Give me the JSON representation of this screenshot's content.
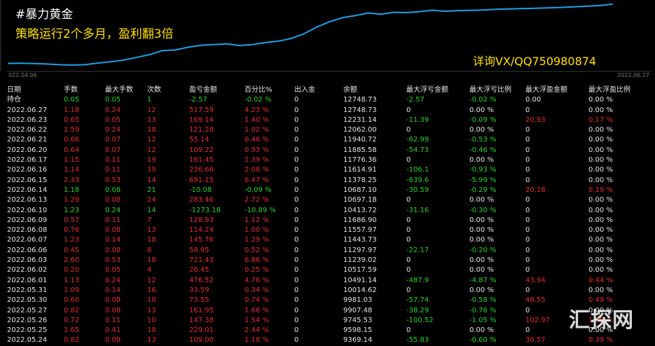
{
  "titles": {
    "strategy_name": "#暴力黄金",
    "subtitle": "策略运行2个多月，盈利翻3倍",
    "contact": "详询VX/QQ750980874"
  },
  "chart_data": {
    "type": "line",
    "x_start_label": "022.04.06",
    "x_end_label": "2022.06.27",
    "color": "#1ea0e6",
    "values": [
      12,
      12.3,
      11.8,
      11,
      10,
      9.5,
      10.2,
      12.5,
      14.5,
      17,
      21,
      25,
      31,
      32,
      36,
      39,
      40,
      41,
      38.5,
      40,
      43,
      45,
      49,
      56,
      66,
      74,
      80,
      83,
      87,
      85,
      88,
      87.5,
      89,
      91,
      89.5,
      90.5,
      90.8,
      91.5,
      92.5,
      93,
      93.5,
      94,
      94.5,
      95.2,
      96,
      97,
      98,
      100
    ],
    "ylim": [
      0,
      100
    ]
  },
  "table": {
    "columns": [
      "日期",
      "手数",
      "最大手数",
      "次数",
      "盈亏金额",
      "百分比%",
      "出入金",
      "余额",
      "最大浮亏金额",
      "最大浮亏比例",
      "最大浮盈金额",
      "最大浮盈比例"
    ],
    "rows": [
      [
        "持仓",
        "0.05",
        "0.05",
        "1",
        "-2.57",
        "-0.02 %",
        "0",
        "12748.73",
        "-2.57",
        "-0.02 %",
        "0.00",
        "0.00 %"
      ],
      [
        "2022.06.27",
        "1.18",
        "0.24",
        "12",
        "517.59",
        "4.23 %",
        "0",
        "12748.73",
        "0",
        "0.00 %",
        "0",
        "0.00 %"
      ],
      [
        "2022.06.23",
        "0.65",
        "0.05",
        "13",
        "169.14",
        "1.40 %",
        "0",
        "12231.14",
        "-11.39",
        "-0.09 %",
        "20.93",
        "0.17 %"
      ],
      [
        "2022.06.22",
        "1.59",
        "0.24",
        "18",
        "121.28",
        "1.02 %",
        "0",
        "12062.00",
        "0",
        "0.00 %",
        "0",
        "0.00 %"
      ],
      [
        "2022.06.21",
        "0.66",
        "0.07",
        "12",
        "55.14",
        "0.46 %",
        "0",
        "11940.72",
        "-62.99",
        "-0.53 %",
        "0",
        "0.00 %"
      ],
      [
        "2022.06.20",
        "0.64",
        "0.07",
        "12",
        "109.22",
        "0.93 %",
        "0",
        "11885.58",
        "-54.73",
        "-0.46 %",
        "0",
        "0.00 %"
      ],
      [
        "2022.06.17",
        "1.15",
        "0.11",
        "19",
        "161.45",
        "1.39 %",
        "0",
        "11776.36",
        "0",
        "0.00 %",
        "0",
        "0.00 %"
      ],
      [
        "2022.06.16",
        "1.14",
        "0.11",
        "19",
        "236.66",
        "2.08 %",
        "0",
        "11614.91",
        "-106.1",
        "-0.93 %",
        "0",
        "0.00 %"
      ],
      [
        "2022.06.15",
        "2.33",
        "0.53",
        "14",
        "691.15",
        "6.47 %",
        "0",
        "11378.25",
        "-639.6",
        "-5.99 %",
        "0",
        "0.00 %"
      ],
      [
        "2022.06.14",
        "1.18",
        "0.08",
        "21",
        "-10.08",
        "-0.09 %",
        "0",
        "10687.10",
        "-30.59",
        "-0.29 %",
        "20.18",
        "0.19 %"
      ],
      [
        "2022.06.13",
        "1.29",
        "0.08",
        "24",
        "283.46",
        "2.72 %",
        "0",
        "10697.18",
        "0",
        "0.00 %",
        "0",
        "0.00 %"
      ],
      [
        "2022.06.10",
        "1.23",
        "0.24",
        "14",
        "-1273.18",
        "-10.89 %",
        "0",
        "10413.72",
        "-31.16",
        "-0.30 %",
        "0",
        "0.00 %"
      ],
      [
        "2022.06.09",
        "0.57",
        "0.11",
        "7",
        "128.93",
        "1.12 %",
        "0",
        "11686.90",
        "0",
        "0.00 %",
        "0",
        "0.00 %"
      ],
      [
        "2022.06.08",
        "0.76",
        "0.08",
        "13",
        "114.24",
        "1.00 %",
        "0",
        "11557.97",
        "0",
        "0.00 %",
        "0",
        "0.00 %"
      ],
      [
        "2022.06.07",
        "1.23",
        "0.14",
        "18",
        "145.76",
        "1.29 %",
        "0",
        "11443.73",
        "0",
        "0.00 %",
        "0",
        "0.00 %"
      ],
      [
        "2022.06.06",
        "0.45",
        "0.08",
        "8",
        "58.95",
        "0.52 %",
        "0",
        "11297.97",
        "-22.17",
        "-0.20 %",
        "0",
        "0.00 %"
      ],
      [
        "2022.06.03",
        "2.60",
        "0.53",
        "18",
        "721.43",
        "6.86 %",
        "0",
        "11239.02",
        "0",
        "0.00 %",
        "0",
        "0.00 %"
      ],
      [
        "2022.06.02",
        "0.20",
        "0.05",
        "4",
        "26.45",
        "0.25 %",
        "0",
        "10517.59",
        "0",
        "0.00 %",
        "0",
        "0.00 %"
      ],
      [
        "2022.06.01",
        "1.13",
        "0.24",
        "12",
        "476.52",
        "4.76 %",
        "0",
        "10491.14",
        "-487.9",
        "-4.87 %",
        "43.94",
        "0.44 %"
      ],
      [
        "2022.05.31",
        "1.09",
        "0.14",
        "16",
        "33.59",
        "0.34 %",
        "0",
        "10014.62",
        "0",
        "0.00 %",
        "0",
        "0.00 %"
      ],
      [
        "2022.05.30",
        "0.60",
        "0.08",
        "10",
        "73.55",
        "0.74 %",
        "0",
        "9981.03",
        "-57.74",
        "-0.58 %",
        "48.55",
        "0.49 %"
      ],
      [
        "2022.05.27",
        "0.82",
        "0.08",
        "13",
        "161.95",
        "1.66 %",
        "0",
        "9907.48",
        "-38.29",
        "-0.76 %",
        "0",
        "0.00 %"
      ],
      [
        "2022.05.26",
        "0.72",
        "0.11",
        "10",
        "147.38",
        "1.54 %",
        "0",
        "9745.53",
        "-100.52",
        "-1.05 %",
        "102.97",
        "1.08 %"
      ],
      [
        "2022.05.25",
        "1.65",
        "0.41",
        "18",
        "229.01",
        "2.44 %",
        "0",
        "9598.15",
        "0",
        "0.00 %",
        "0",
        "0.00 %"
      ],
      [
        "2022.05.24",
        "0.82",
        "0.08",
        "13",
        "109.00",
        "1.18 %",
        "0",
        "9369.14",
        "-55.83",
        "-0.60 %",
        "36.57",
        "0.39 %"
      ]
    ]
  },
  "watermark": "汇探网",
  "colors": {
    "positive": "#e23030",
    "negative": "#2bd12b",
    "neutral": "#e6e6e6",
    "line": "#1ea0e6",
    "title_yellow": "#ffe000",
    "background": "#000000"
  }
}
